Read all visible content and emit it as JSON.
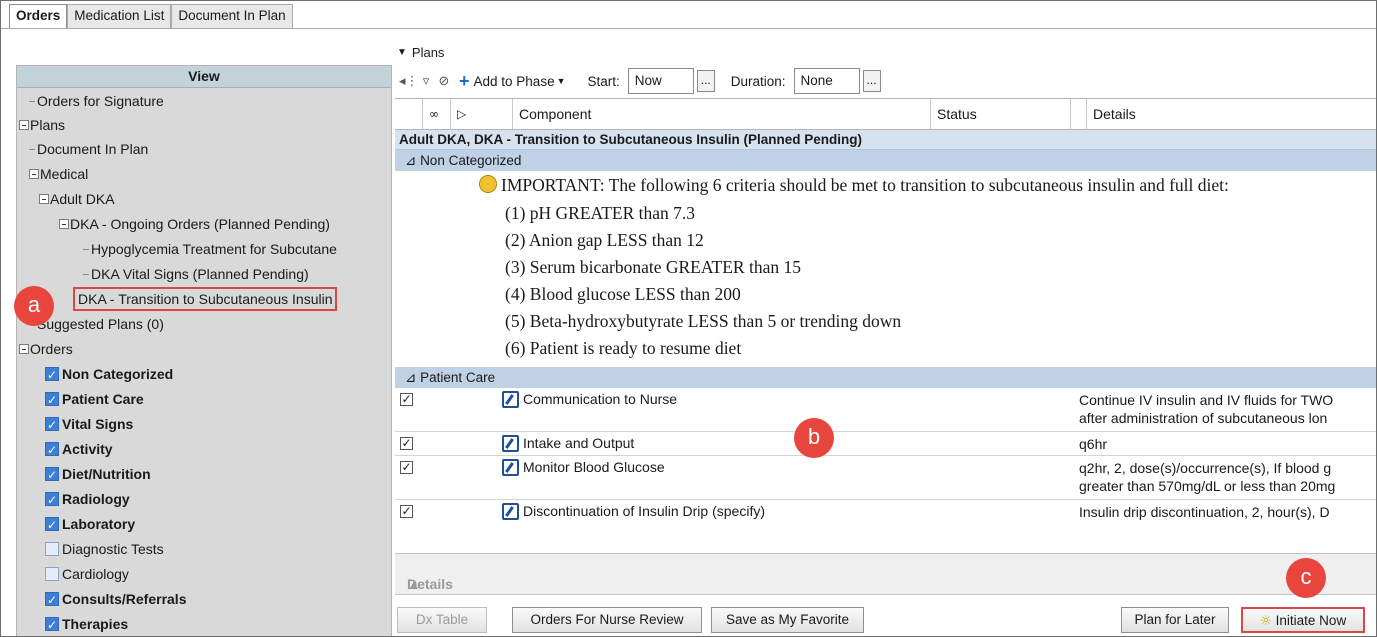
{
  "tabs": [
    "Orders",
    "Medication List",
    "Document In Plan"
  ],
  "left": {
    "header": "View",
    "tree": [
      {
        "label": "Orders for Signature",
        "type": "leaf"
      },
      {
        "label": "Plans",
        "type": "group"
      },
      {
        "label": "Document In Plan",
        "type": "leaf"
      },
      {
        "label": "Medical",
        "type": "group"
      },
      {
        "label": "Adult DKA",
        "type": "group"
      },
      {
        "label": "DKA - Ongoing Orders (Planned Pending)",
        "type": "group"
      },
      {
        "label": "Hypoglycemia Treatment for Subcutane",
        "type": "leaf"
      },
      {
        "label": "DKA Vital Signs (Planned Pending)",
        "type": "leaf"
      },
      {
        "label": "DKA - Transition to Subcutaneous Insulin",
        "type": "selected"
      },
      {
        "label": "Suggested Plans (0)",
        "type": "leaf"
      },
      {
        "label": "Orders",
        "type": "group"
      }
    ],
    "categories": [
      {
        "label": "Non Categorized",
        "checked": true
      },
      {
        "label": "Patient Care",
        "checked": true
      },
      {
        "label": "Vital Signs",
        "checked": true
      },
      {
        "label": "Activity",
        "checked": true
      },
      {
        "label": "Diet/Nutrition",
        "checked": true
      },
      {
        "label": "Radiology",
        "checked": true
      },
      {
        "label": "Laboratory",
        "checked": true
      },
      {
        "label": "Diagnostic Tests",
        "checked": false
      },
      {
        "label": "Cardiology",
        "checked": false
      },
      {
        "label": "Consults/Referrals",
        "checked": true
      },
      {
        "label": "Therapies",
        "checked": true
      }
    ]
  },
  "plans_label": "Plans",
  "toolbar": {
    "add_to_phase": "Add to Phase",
    "start_label": "Start:",
    "start_value": "Now",
    "duration_label": "Duration:",
    "duration_value": "None",
    "dots": "..."
  },
  "grid": {
    "columns": [
      "Component",
      "Status",
      "Details"
    ],
    "plan_title": "Adult DKA, DKA - Transition to Subcutaneous Insulin (Planned Pending)",
    "section_noncat": "Non Categorized",
    "note_lines": [
      "IMPORTANT: The following 6 criteria should be met to transition to subcutaneous insulin and full diet:",
      "(1) pH GREATER than 7.3",
      "(2) Anion gap LESS than 12",
      "(3) Serum bicarbonate GREATER than 15",
      "(4) Blood glucose LESS than 200",
      "(5) Beta-hydroxybutyrate LESS than 5 or trending down",
      "(6) Patient is ready to resume diet"
    ],
    "section_patientcare": "Patient Care",
    "orders": [
      {
        "component": "Communication to Nurse",
        "details": [
          "Continue IV insulin and IV fluids for TWO",
          "after administration of subcutaneous lon"
        ]
      },
      {
        "component": "Intake and Output",
        "details": [
          "q6hr"
        ]
      },
      {
        "component": "Monitor Blood Glucose",
        "details": [
          "q2hr, 2, dose(s)/occurrence(s), If blood g",
          "greater than 570mg/dL or less than 20mg"
        ]
      },
      {
        "component": "Discontinuation of Insulin Drip (specify)",
        "details": [
          "Insulin drip discontinuation, 2, hour(s), D"
        ]
      }
    ]
  },
  "details_label": "Details",
  "buttons": {
    "dx_table": "Dx Table",
    "orders_for_nurse_review": "Orders For Nurse Review",
    "save_as_favorite": "Save as My Favorite",
    "plan_for_later": "Plan for Later",
    "initiate_now": "Initiate Now"
  },
  "callouts": {
    "a": "a",
    "b": "b",
    "c": "c"
  },
  "colors": {
    "callout": "#e8453c",
    "highlight_border": "#e04545",
    "plan_row": "#d7e2ef",
    "category_row": "#bfd1e5",
    "tree_bg": "#d9d9d9"
  }
}
